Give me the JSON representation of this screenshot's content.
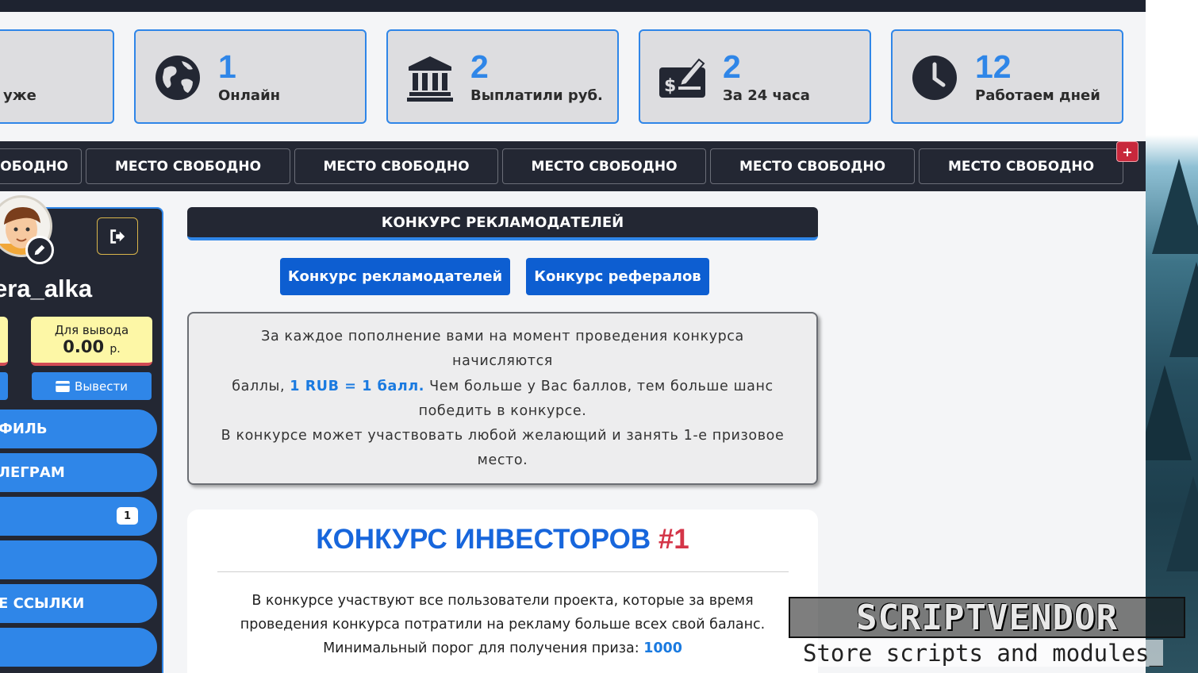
{
  "stats": [
    {
      "value": "",
      "label": "уже",
      "icon": "users-icon"
    },
    {
      "value": "1",
      "label": "Онлайн",
      "icon": "globe-icon"
    },
    {
      "value": "2",
      "label": "Выплатили руб.",
      "icon": "bank-icon"
    },
    {
      "value": "2",
      "label": "За 24 часа",
      "icon": "cheque-icon"
    },
    {
      "value": "12",
      "label": "Работаем дней",
      "icon": "clock-icon"
    }
  ],
  "ticker": {
    "slots": [
      "МЕСТО СВОБОДНО",
      "МЕСТО СВОБОДНО",
      "МЕСТО СВОБОДНО",
      "МЕСТО СВОБОДНО",
      "МЕСТО СВОБОДНО",
      "МЕСТО СВОБОДНО"
    ],
    "add_label": "+"
  },
  "sidebar": {
    "username": "era_alka",
    "withdraw_box": {
      "title": "Для вывода",
      "amount": "0.00",
      "currency": "р."
    },
    "withdraw_button": "Вывести",
    "nav": [
      {
        "label": "ФИЛЬ"
      },
      {
        "label": "ЛЕГРАМ"
      },
      {
        "label": "",
        "badge": "1"
      },
      {
        "label": ""
      },
      {
        "label": "Е ССЫЛКИ"
      },
      {
        "label": ""
      }
    ]
  },
  "main": {
    "section_title": "КОНКУРС РЕКЛАМОДАТЕЛЕЙ",
    "tabs": [
      "Конкурс рекламодателей",
      "Конкурс рефералов"
    ],
    "info": {
      "line1": "За каждое пополнение вами на момент проведения конкурса начисляются",
      "line2a": "баллы, ",
      "line2_highlight": "1 RUB = 1 балл.",
      "line2b": " Чем больше у Вас баллов, тем больше шанс победить в конкурсе.",
      "line3": "В конкурсе может участвовать любой желающий и занять 1-е призовое место."
    },
    "contest": {
      "title": "КОНКУРС ИНВЕСТОРОВ ",
      "number": "#1",
      "text": "В конкурсе участвуют все пользователи проекта, которые за время проведения конкурса потратили на рекламу больше всех свой баланс.",
      "threshold_label": "Минимальный порог для получения приза: ",
      "threshold_value": "1000"
    }
  },
  "watermark": {
    "logo": "SCRIPTVENDOR",
    "tagline": "Store scripts and modules_"
  },
  "colors": {
    "accent": "#2f86e8",
    "dark": "#232733",
    "red": "#d43548",
    "yellow": "#fdf7a6"
  }
}
